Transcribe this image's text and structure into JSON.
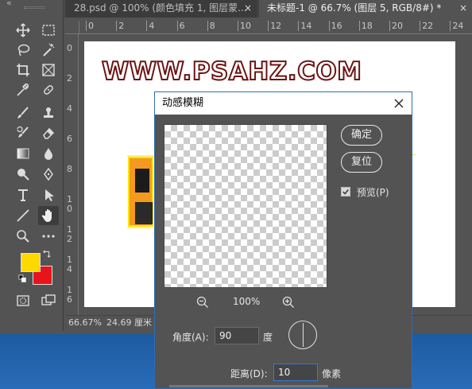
{
  "tabs": [
    {
      "label": "28.psd @ 100% (颜色填充 1, 图层蒙...",
      "close": "×"
    },
    {
      "label": "未标题-1 @ 66.7% (图层 5, RGB/8#) *",
      "close": "×"
    }
  ],
  "toolbar": {
    "collapse": "«",
    "tools": [
      "move-icon",
      "marquee-icon",
      "lasso-icon",
      "magic-wand-icon",
      "crop-icon",
      "frame-icon",
      "eyedropper-icon",
      "healing-brush-icon",
      "brush-icon",
      "stamp-icon",
      "history-brush-icon",
      "eraser-icon",
      "gradient-icon",
      "blur-icon",
      "dodge-icon",
      "pen-icon",
      "type-icon",
      "path-select-icon",
      "line-icon",
      "hand-icon",
      "zoom-icon",
      "more-icon"
    ],
    "foreground_color": "#ffd800",
    "background_color": "#e8141b"
  },
  "ruler_top": [
    "0",
    "2",
    "4",
    "6",
    "8",
    "10",
    "12",
    "14",
    "16",
    "18",
    "20",
    "22",
    "24"
  ],
  "ruler_left": [
    "0",
    "2",
    "4",
    "6",
    "8",
    "1\n0",
    "1\n2",
    "1\n4",
    "1\n6"
  ],
  "canvas": {
    "watermark": "WWW.PSAHZ.COM"
  },
  "status": {
    "zoom": "66.67%",
    "size": "24.69 厘米"
  },
  "dialog": {
    "title": "动感模糊",
    "ok": "确定",
    "reset": "复位",
    "preview_label": "预览(P)",
    "preview_checked": true,
    "zoom_value": "100%",
    "angle_label": "角度(A):",
    "angle_value": "90",
    "angle_unit": "度",
    "distance_label": "距离(D):",
    "distance_value": "10",
    "distance_unit": "像素"
  }
}
